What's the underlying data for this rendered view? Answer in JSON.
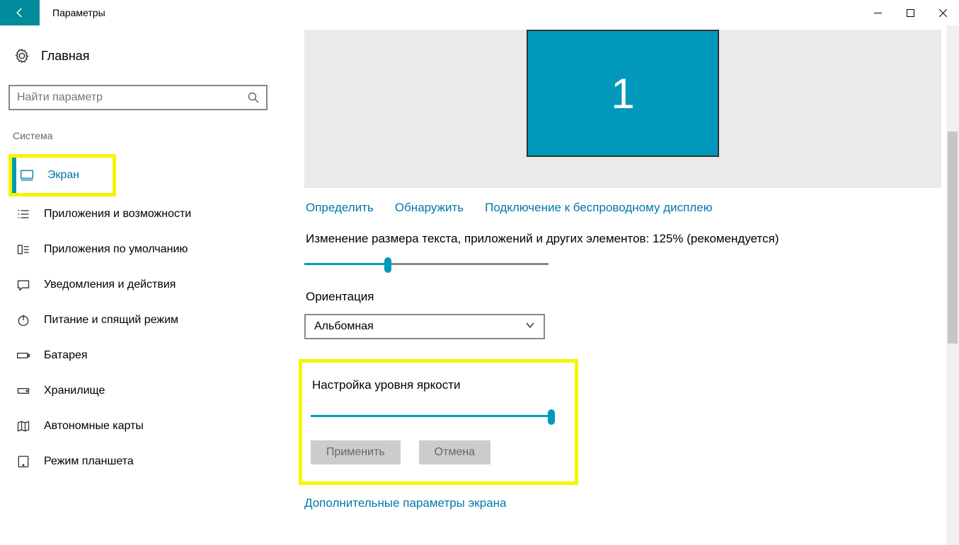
{
  "titlebar": {
    "title": "Параметры"
  },
  "sidebar": {
    "home": "Главная",
    "search_placeholder": "Найти параметр",
    "category": "Система",
    "items": [
      {
        "label": "Экран",
        "active": true
      },
      {
        "label": "Приложения и возможности"
      },
      {
        "label": "Приложения по умолчанию"
      },
      {
        "label": "Уведомления и действия"
      },
      {
        "label": "Питание и спящий режим"
      },
      {
        "label": "Батарея"
      },
      {
        "label": "Хранилище"
      },
      {
        "label": "Автономные карты"
      },
      {
        "label": "Режим планшета"
      }
    ]
  },
  "main": {
    "monitor_number": "1",
    "links": {
      "identify": "Определить",
      "detect": "Обнаружить",
      "wireless": "Подключение к беспроводному дисплею"
    },
    "scale_label": "Изменение размера текста, приложений и других элементов: 125% (рекомендуется)",
    "orientation_label": "Ориентация",
    "orientation_value": "Альбомная",
    "brightness_label": "Настройка уровня яркости",
    "apply": "Применить",
    "cancel": "Отмена",
    "advanced": "Дополнительные параметры экрана"
  }
}
